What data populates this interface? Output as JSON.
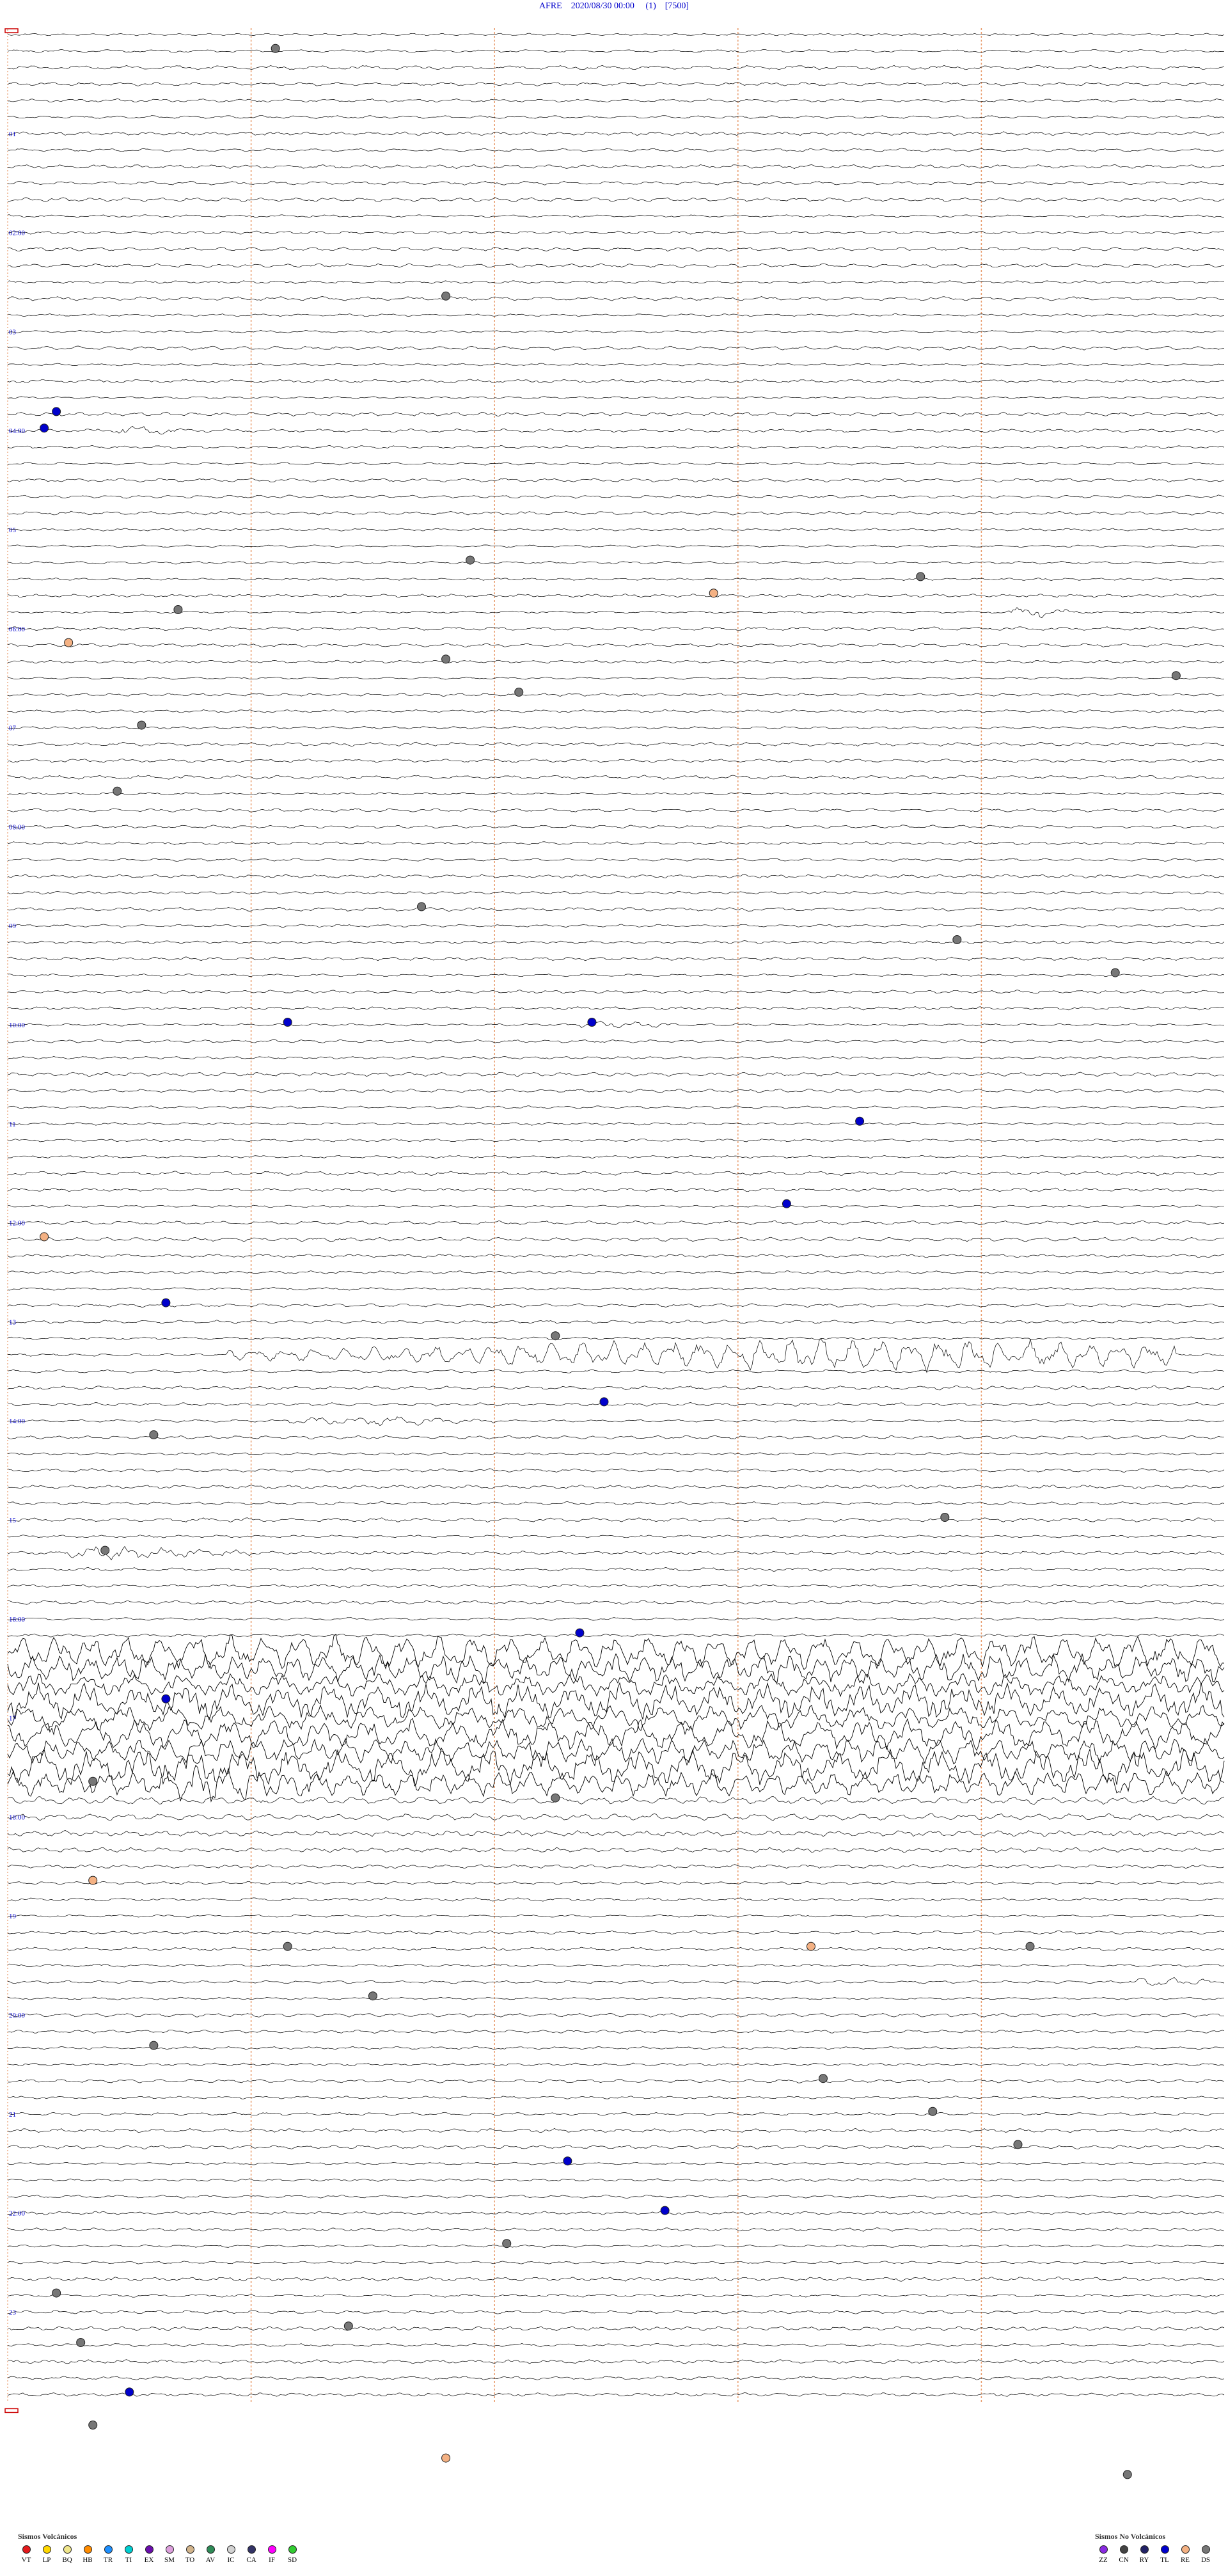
{
  "title": {
    "station": "AFRE",
    "datetime": "2020/08/30 00:00",
    "channel": "(1)",
    "bracket": "[7500]"
  },
  "colors": {
    "trace": "#000000",
    "hour_label": "#0000cc",
    "minute_marker": "#e89a6a",
    "frame_marker": "#cc0000"
  },
  "chart_data": {
    "type": "seismogram-helicorder",
    "rows": 144,
    "minutes_per_row": 10,
    "columns_per_row_minutes": [
      0,
      2,
      4,
      6,
      8,
      10
    ],
    "minute_marker_positions_min": [
      2,
      4,
      6,
      8
    ],
    "hour_labels": [
      {
        "row": 0,
        "text": ""
      },
      {
        "row": 6,
        "text": "01"
      },
      {
        "row": 12,
        "text": "02:00"
      },
      {
        "row": 18,
        "text": "03"
      },
      {
        "row": 24,
        "text": "04:00"
      },
      {
        "row": 30,
        "text": "05"
      },
      {
        "row": 36,
        "text": "06:00"
      },
      {
        "row": 42,
        "text": "07"
      },
      {
        "row": 48,
        "text": "08:00"
      },
      {
        "row": 54,
        "text": "09"
      },
      {
        "row": 60,
        "text": "10:00"
      },
      {
        "row": 66,
        "text": "11"
      },
      {
        "row": 72,
        "text": "12:00"
      },
      {
        "row": 78,
        "text": "13"
      },
      {
        "row": 84,
        "text": "14:00"
      },
      {
        "row": 90,
        "text": "15"
      },
      {
        "row": 96,
        "text": "16:00"
      },
      {
        "row": 102,
        "text": "17"
      },
      {
        "row": 108,
        "text": "18:00"
      },
      {
        "row": 114,
        "text": "19"
      },
      {
        "row": 120,
        "text": "20:00"
      },
      {
        "row": 126,
        "text": "21"
      },
      {
        "row": 132,
        "text": "22:00"
      },
      {
        "row": 138,
        "text": "23"
      }
    ],
    "high_amplitude_rows": [
      98,
      99,
      100,
      101,
      102,
      103,
      104,
      105,
      106
    ],
    "burst_events": [
      {
        "row": 80,
        "start_min": 1.8,
        "end_min": 9.6,
        "peak_min": 6.8,
        "amplitude": 18
      },
      {
        "row": 84,
        "start_min": 2.3,
        "end_min": 4.0,
        "peak_min": 3.0,
        "amplitude": 4
      },
      {
        "row": 92,
        "start_min": 0.5,
        "end_min": 2.0,
        "peak_min": 0.8,
        "amplitude": 6
      },
      {
        "row": 106,
        "start_min": 1.2,
        "end_min": 2.5,
        "peak_min": 1.6,
        "amplitude": 8
      },
      {
        "row": 35,
        "start_min": 8.2,
        "end_min": 8.8,
        "peak_min": 8.4,
        "amplitude": 6
      },
      {
        "row": 24,
        "start_min": 0.9,
        "end_min": 1.5,
        "peak_min": 1.0,
        "amplitude": 4
      },
      {
        "row": 118,
        "start_min": 9.2,
        "end_min": 9.9,
        "peak_min": 9.5,
        "amplitude": 4
      },
      {
        "row": 60,
        "start_min": 4.7,
        "end_min": 5.5,
        "peak_min": 5.0,
        "amplitude": 3
      }
    ],
    "event_markers": [
      {
        "row": 1,
        "minute": 2.2,
        "class": "DS"
      },
      {
        "row": 16,
        "minute": 3.6,
        "class": "DS"
      },
      {
        "row": 23,
        "minute": 0.4,
        "class": "TL"
      },
      {
        "row": 24,
        "minute": 0.3,
        "class": "TL"
      },
      {
        "row": 32,
        "minute": 3.8,
        "class": "DS"
      },
      {
        "row": 35,
        "minute": 1.4,
        "class": "DS"
      },
      {
        "row": 34,
        "minute": 5.8,
        "class": "RE"
      },
      {
        "row": 33,
        "minute": 7.5,
        "class": "DS"
      },
      {
        "row": 37,
        "minute": 0.5,
        "class": "RE"
      },
      {
        "row": 38,
        "minute": 3.6,
        "class": "DS"
      },
      {
        "row": 39,
        "minute": 9.6,
        "class": "DS"
      },
      {
        "row": 40,
        "minute": 4.2,
        "class": "DS"
      },
      {
        "row": 42,
        "minute": 1.1,
        "class": "DS"
      },
      {
        "row": 46,
        "minute": 0.9,
        "class": "DS"
      },
      {
        "row": 53,
        "minute": 3.4,
        "class": "DS"
      },
      {
        "row": 55,
        "minute": 7.8,
        "class": "DS"
      },
      {
        "row": 57,
        "minute": 9.1,
        "class": "DS"
      },
      {
        "row": 60,
        "minute": 2.3,
        "class": "TL"
      },
      {
        "row": 60,
        "minute": 4.8,
        "class": "TL"
      },
      {
        "row": 66,
        "minute": 7.0,
        "class": "TL"
      },
      {
        "row": 71,
        "minute": 6.4,
        "class": "TL"
      },
      {
        "row": 73,
        "minute": 0.3,
        "class": "RE"
      },
      {
        "row": 77,
        "minute": 1.3,
        "class": "TL"
      },
      {
        "row": 79,
        "minute": 4.5,
        "class": "DS"
      },
      {
        "row": 83,
        "minute": 4.9,
        "class": "TL"
      },
      {
        "row": 85,
        "minute": 1.2,
        "class": "DS"
      },
      {
        "row": 90,
        "minute": 7.7,
        "class": "DS"
      },
      {
        "row": 92,
        "minute": 0.8,
        "class": "DS"
      },
      {
        "row": 97,
        "minute": 4.7,
        "class": "TL"
      },
      {
        "row": 101,
        "minute": 1.3,
        "class": "TL"
      },
      {
        "row": 106,
        "minute": 0.7,
        "class": "DS"
      },
      {
        "row": 107,
        "minute": 4.5,
        "class": "DS"
      },
      {
        "row": 112,
        "minute": 0.7,
        "class": "RE"
      },
      {
        "row": 116,
        "minute": 2.3,
        "class": "DS"
      },
      {
        "row": 116,
        "minute": 6.6,
        "class": "RE"
      },
      {
        "row": 116,
        "minute": 8.4,
        "class": "DS"
      },
      {
        "row": 119,
        "minute": 3.0,
        "class": "DS"
      },
      {
        "row": 122,
        "minute": 1.2,
        "class": "DS"
      },
      {
        "row": 124,
        "minute": 6.7,
        "class": "DS"
      },
      {
        "row": 126,
        "minute": 7.6,
        "class": "DS"
      },
      {
        "row": 128,
        "minute": 8.3,
        "class": "DS"
      },
      {
        "row": 129,
        "minute": 4.6,
        "class": "TL"
      },
      {
        "row": 132,
        "minute": 5.4,
        "class": "TL"
      },
      {
        "row": 134,
        "minute": 4.1,
        "class": "DS"
      },
      {
        "row": 137,
        "minute": 0.4,
        "class": "DS"
      },
      {
        "row": 139,
        "minute": 2.8,
        "class": "DS"
      },
      {
        "row": 140,
        "minute": 0.6,
        "class": "DS"
      },
      {
        "row": 143,
        "minute": 1.0,
        "class": "TL"
      },
      {
        "row": 145,
        "minute": 0.7,
        "class": "DS"
      },
      {
        "row": 147,
        "minute": 3.6,
        "class": "RE"
      },
      {
        "row": 148,
        "minute": 9.2,
        "class": "DS"
      }
    ],
    "legend_volcanic": {
      "title": "Sismos Volcánicos",
      "items": [
        {
          "code": "VT",
          "color": "#e41a1c"
        },
        {
          "code": "LP",
          "color": "#ffd700"
        },
        {
          "code": "BQ",
          "color": "#f0e68c"
        },
        {
          "code": "HB",
          "color": "#ff8c00"
        },
        {
          "code": "TR",
          "color": "#1e90ff"
        },
        {
          "code": "TI",
          "color": "#00ced1"
        },
        {
          "code": "EX",
          "color": "#6a0dad"
        },
        {
          "code": "SM",
          "color": "#dda0dd"
        },
        {
          "code": "TO",
          "color": "#d2b48c"
        },
        {
          "code": "AV",
          "color": "#2e8b57"
        },
        {
          "code": "IC",
          "color": "#d3d3d3"
        },
        {
          "code": "CA",
          "color": "#333366"
        },
        {
          "code": "IF",
          "color": "#ff00ff"
        },
        {
          "code": "SD",
          "color": "#32cd32"
        }
      ]
    },
    "legend_nonvolcanic": {
      "title": "Sismos No Volcánicos",
      "items": [
        {
          "code": "ZZ",
          "color": "#8a2be2"
        },
        {
          "code": "CN",
          "color": "#444444"
        },
        {
          "code": "RY",
          "color": "#222266"
        },
        {
          "code": "TL",
          "color": "#0000cc"
        },
        {
          "code": "RE",
          "color": "#f4b183"
        },
        {
          "code": "DS",
          "color": "#777777"
        }
      ]
    }
  }
}
